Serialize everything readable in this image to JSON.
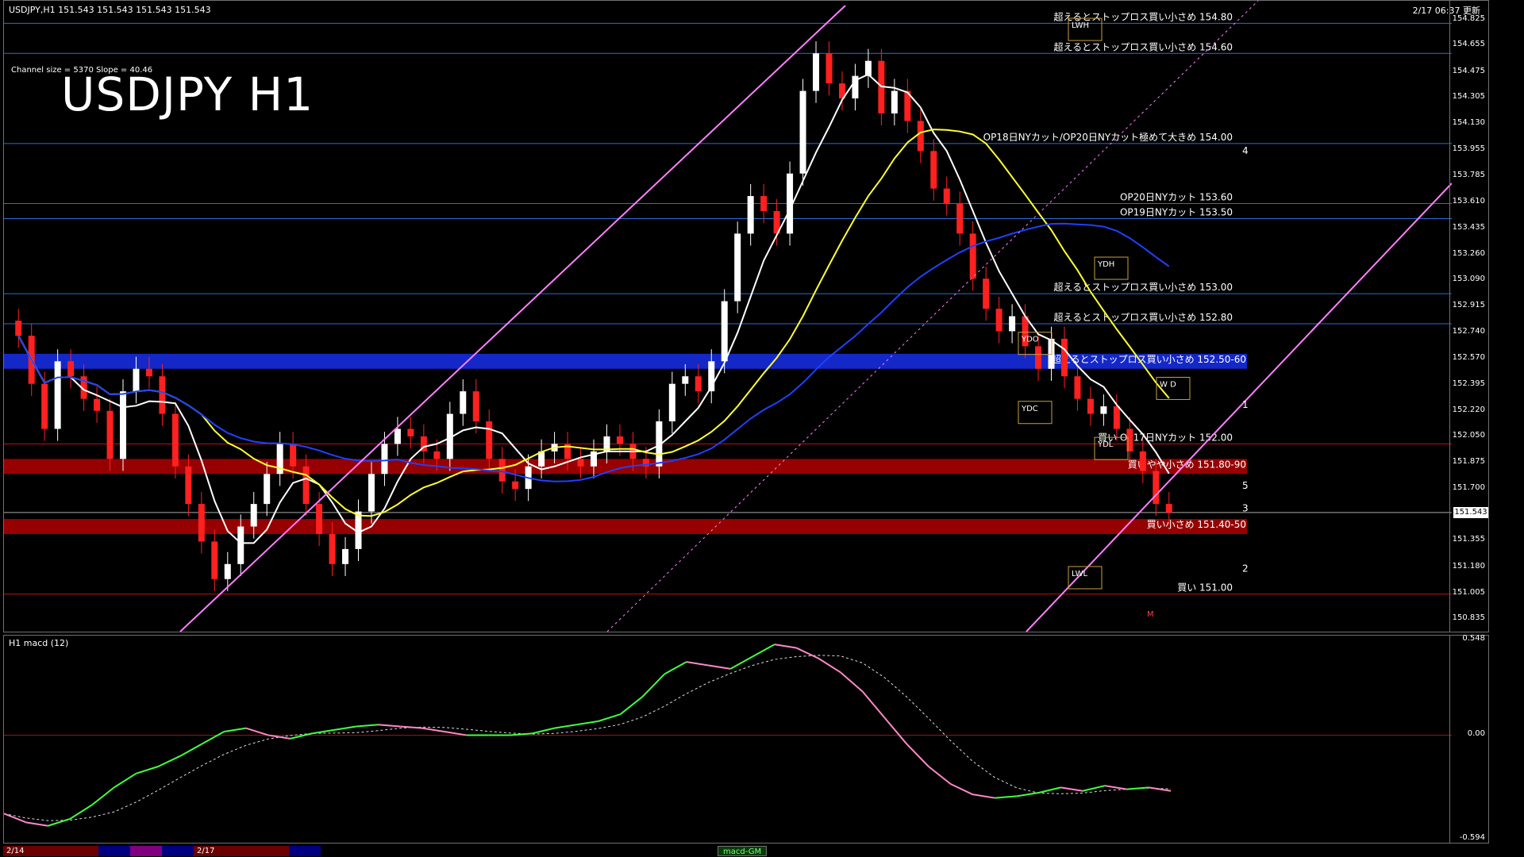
{
  "header": {
    "symbol_line": "USDJPY,H1  151.543 151.543 151.543 151.543",
    "channel_info": "Channel size = 5370  Slope = 40.46",
    "big_title": "USDJPY H1",
    "datetime": "2/17 06:37 更新"
  },
  "price_axis": {
    "ticks": [
      "154.825",
      "154.655",
      "154.475",
      "154.305",
      "154.130",
      "153.955",
      "153.785",
      "153.610",
      "153.435",
      "153.260",
      "153.090",
      "152.915",
      "152.740",
      "152.570",
      "152.395",
      "152.220",
      "152.050",
      "151.875",
      "151.700",
      "151.525",
      "151.355",
      "151.180",
      "151.005",
      "150.835"
    ],
    "current_price": "151.543"
  },
  "levels": [
    {
      "price": 154.8,
      "label": "超えるとストップロス買い小さめ 154.80"
    },
    {
      "price": 154.6,
      "label": "超えるとストップロス買い小さめ 154.60"
    },
    {
      "price": 154.0,
      "label": "OP18日NYカット/OP20日NYカット極めて大きめ 154.00"
    },
    {
      "price": 153.6,
      "label": "OP20日NYカット 153.60"
    },
    {
      "price": 153.5,
      "label": "OP19日NYカット 153.50"
    },
    {
      "price": 153.0,
      "label": "超えるとストップロス買い小さめ 153.00"
    },
    {
      "price": 152.8,
      "label": "超えるとストップロス買い小さめ 152.80"
    },
    {
      "price": 152.0,
      "label": "買い OP17日NYカット 152.00"
    },
    {
      "price": 151.0,
      "label": "買い 151.00"
    }
  ],
  "zones": [
    {
      "from": 152.5,
      "to": 152.6,
      "color": "#1428c8",
      "label": "超えるとストップロス買い小さめ 152.50-60"
    },
    {
      "from": 151.8,
      "to": 151.9,
      "color": "#960000",
      "label": "買いやや小さめ 151.80-90"
    },
    {
      "from": 151.4,
      "to": 151.5,
      "color": "#960000",
      "label": "買い小さめ 151.40-50"
    }
  ],
  "markers": {
    "ydh": "YDH",
    "ydo": "YDO",
    "ydc": "YDC",
    "ydl": "YDL",
    "lwh": "LWH",
    "lwl": "LWL",
    "m": "M",
    "wd": "W D",
    "wave_labels": [
      "4",
      "1",
      "5",
      "3",
      "2"
    ]
  },
  "macd": {
    "title": "H1  macd (12)",
    "ticks": [
      "0.548",
      "0.00",
      "-0.594"
    ]
  },
  "timeframe_bar": {
    "labels": [
      "2/14",
      "2/17"
    ],
    "tab_label": "macd-GM"
  },
  "colors": {
    "candle_up": "#ffffff",
    "candle_down": "#ff2020",
    "ma_white": "#ffffff",
    "ma_yellow": "#ffff30",
    "ma_blue": "#2040ff",
    "chikou_green": "#20c020",
    "channel_pink": "#ff80ff",
    "macd_green": "#40ff40",
    "macd_pink": "#ff88c8"
  },
  "chart_data": {
    "type": "candlestick",
    "symbol": "USDJPY",
    "timeframe": "H1",
    "ylim": [
      150.75,
      154.95
    ],
    "close_series": [
      152.72,
      152.4,
      152.1,
      152.55,
      152.45,
      152.3,
      152.22,
      151.9,
      152.35,
      152.5,
      152.45,
      152.2,
      151.85,
      151.6,
      151.35,
      151.1,
      151.2,
      151.45,
      151.6,
      151.8,
      152.0,
      151.85,
      151.6,
      151.4,
      151.2,
      151.3,
      151.55,
      151.8,
      152.0,
      152.1,
      152.05,
      151.95,
      151.9,
      152.2,
      152.35,
      152.15,
      151.9,
      151.75,
      151.7,
      151.85,
      151.95,
      152.0,
      151.9,
      151.85,
      151.95,
      152.05,
      152.0,
      151.9,
      151.85,
      152.15,
      152.4,
      152.45,
      152.35,
      152.55,
      152.95,
      153.4,
      153.65,
      153.55,
      153.4,
      153.8,
      154.35,
      154.6,
      154.4,
      154.3,
      154.45,
      154.55,
      154.2,
      154.35,
      154.15,
      153.95,
      153.7,
      153.6,
      153.4,
      153.1,
      152.9,
      152.75,
      152.85,
      152.65,
      152.5,
      152.7,
      152.45,
      152.3,
      152.2,
      152.25,
      152.1,
      151.95,
      151.82,
      151.6,
      151.543
    ],
    "macd_series": [
      -0.45,
      -0.5,
      -0.52,
      -0.48,
      -0.4,
      -0.3,
      -0.22,
      -0.18,
      -0.12,
      -0.05,
      0.02,
      0.04,
      0.0,
      -0.02,
      0.01,
      0.03,
      0.05,
      0.06,
      0.05,
      0.04,
      0.02,
      0.0,
      0.0,
      0.0,
      0.01,
      0.04,
      0.06,
      0.08,
      0.12,
      0.22,
      0.35,
      0.42,
      0.4,
      0.38,
      0.45,
      0.52,
      0.5,
      0.44,
      0.36,
      0.25,
      0.1,
      -0.05,
      -0.18,
      -0.28,
      -0.34,
      -0.36,
      -0.35,
      -0.33,
      -0.3,
      -0.32,
      -0.29,
      -0.31,
      -0.3,
      -0.32
    ]
  }
}
